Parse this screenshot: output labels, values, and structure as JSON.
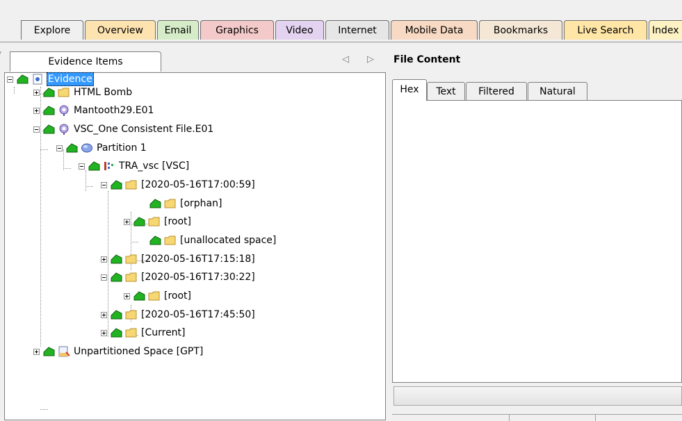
{
  "main_tabs": [
    {
      "label": "Explore",
      "bg": "#f0f0f0"
    },
    {
      "label": "Overview",
      "bg": "#fde3b0"
    },
    {
      "label": "Email",
      "bg": "#d6ecc8"
    },
    {
      "label": "Graphics",
      "bg": "#f4c9c9"
    },
    {
      "label": "Video",
      "bg": "#e4d3f0"
    },
    {
      "label": "Internet",
      "bg": "#e6e6e6"
    },
    {
      "label": "Mobile Data",
      "bg": "#f8d9c3"
    },
    {
      "label": "Bookmarks",
      "bg": "#f4e7d6"
    },
    {
      "label": "Live Search",
      "bg": "#ffe6a6"
    },
    {
      "label": "Index",
      "bg": "#fdf2c4"
    }
  ],
  "left_pane": {
    "tab_label": "Evidence Items",
    "nav_prev_icon": "triangle-left-icon",
    "nav_next_icon": "triangle-right-icon"
  },
  "tree": {
    "items": [
      {
        "label": "Evidence",
        "icon": "evidence-icon",
        "expander": "minus",
        "selected": true
      },
      {
        "label": "HTML Bomb",
        "icon": "folder-icon",
        "expander": "plus"
      },
      {
        "label": "Mantooth29.E01",
        "icon": "magnifier-disk-icon",
        "expander": "plus"
      },
      {
        "label": "VSC_One Consistent File.E01",
        "icon": "magnifier-disk-icon",
        "expander": "minus"
      },
      {
        "label": "Partition 1",
        "icon": "partition-icon",
        "expander": "minus"
      },
      {
        "label": "TRA_vsc [VSC]",
        "icon": "vsc-icon",
        "expander": "minus"
      },
      {
        "label": "[2020-05-16T17:00:59]",
        "icon": "folder-icon",
        "expander": "minus"
      },
      {
        "label": "[orphan]",
        "icon": "folder-icon",
        "expander": "none"
      },
      {
        "label": "[root]",
        "icon": "folder-icon",
        "expander": "plus"
      },
      {
        "label": "[unallocated space]",
        "icon": "folder-icon",
        "expander": "none"
      },
      {
        "label": "[2020-05-16T17:15:18]",
        "icon": "folder-icon",
        "expander": "plus"
      },
      {
        "label": "[2020-05-16T17:30:22]",
        "icon": "folder-icon",
        "expander": "minus"
      },
      {
        "label": "[root]",
        "icon": "folder-icon",
        "expander": "plus"
      },
      {
        "label": "[2020-05-16T17:45:50]",
        "icon": "folder-icon",
        "expander": "plus"
      },
      {
        "label": "[Current]",
        "icon": "folder-icon",
        "expander": "plus"
      },
      {
        "label": "Unpartitioned Space [GPT]",
        "icon": "unpartitioned-icon",
        "expander": "plus"
      }
    ]
  },
  "right_pane": {
    "title": "File Content",
    "tabs": [
      {
        "label": "Hex",
        "active": true
      },
      {
        "label": "Text",
        "active": false
      },
      {
        "label": "Filtered",
        "active": false
      },
      {
        "label": "Natural",
        "active": false
      }
    ]
  },
  "colors": {
    "selection": "#3399ff",
    "folder": "#f7d774",
    "green_arrow": "#22b322"
  }
}
